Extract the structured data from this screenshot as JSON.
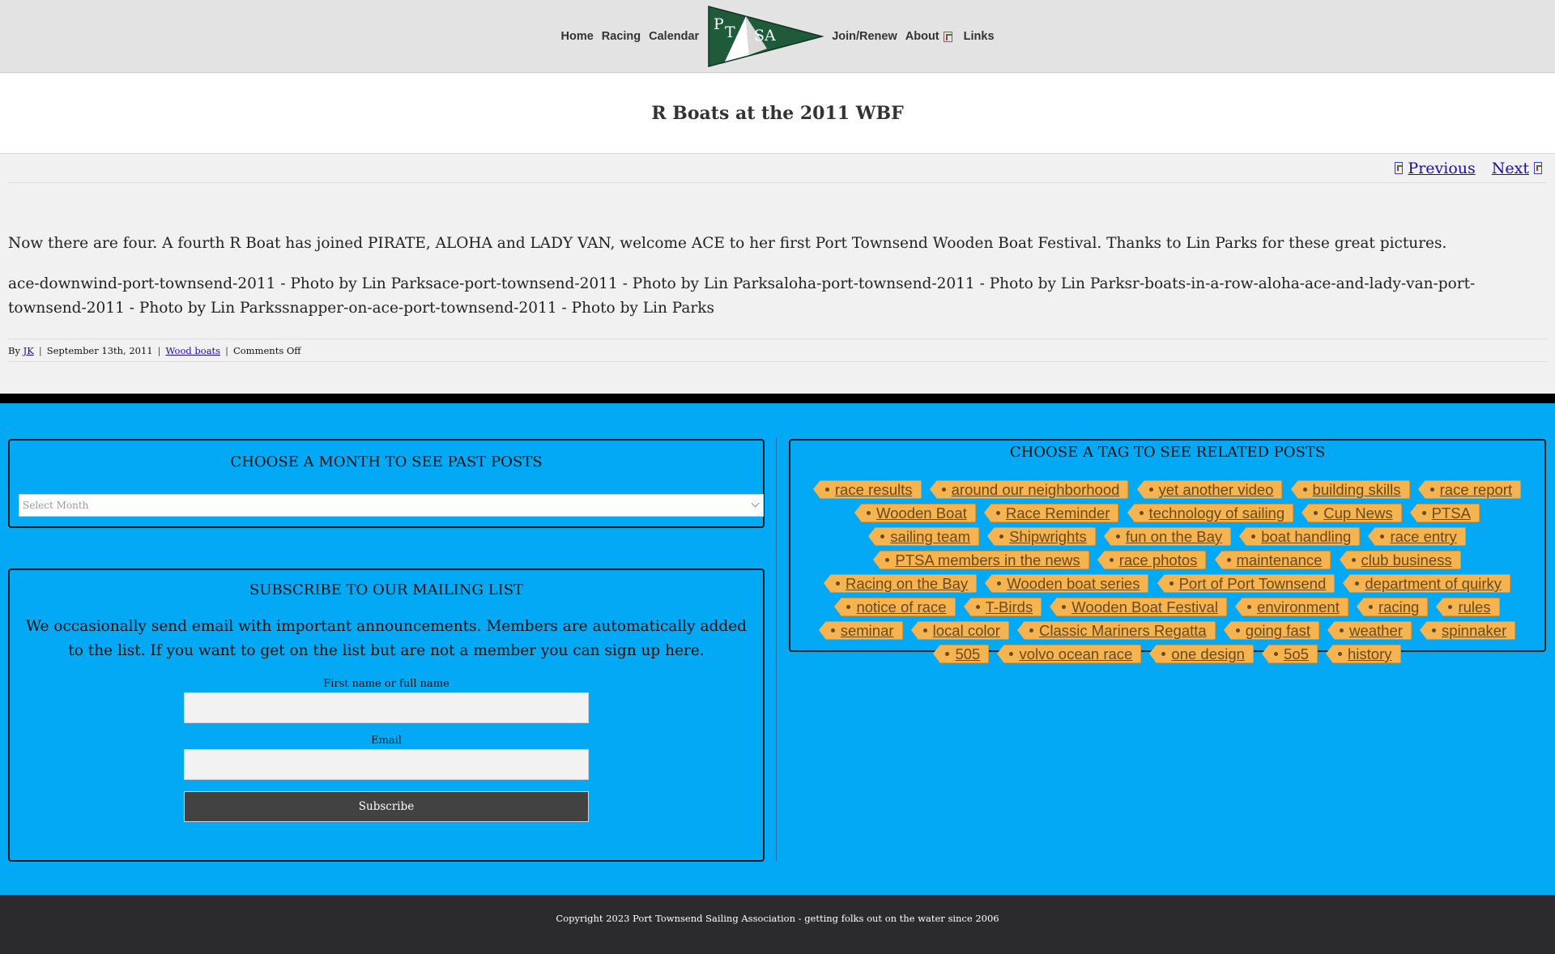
{
  "nav": {
    "items_left": [
      "Home",
      "Racing",
      "Calendar"
    ],
    "logo_letters": [
      "P",
      "T",
      "SA"
    ],
    "items_right": [
      "Join/Renew",
      "About",
      "Links"
    ],
    "brand_color": "#1f5a3a"
  },
  "post": {
    "title": "R Boats at the 2011 WBF",
    "nav_previous": "Previous",
    "nav_next": "Next",
    "paragraph1": "Now there are four. A fourth R Boat has joined PIRATE, ALOHA and LADY VAN, welcome ACE to her first Port Townsend Wooden Boat Festival. Thanks to Lin Parks for these great pictures.",
    "paragraph2": "ace-downwind-port-townsend-2011 - Photo by Lin Parksace-port-townsend-2011 - Photo by Lin Parksaloha-port-townsend-2011 - Photo by Lin Parksr-boats-in-a-row-aloha-ace-and-lady-van-port-townsend-2011 - Photo by Lin Parkssnapper-on-ace-port-townsend-2011 - Photo by Lin Parks",
    "meta": {
      "by": "By",
      "author": "JK",
      "date": "September 13th, 2011",
      "category": "Wood boats",
      "comments": "Comments Off"
    }
  },
  "archive": {
    "heading": "CHOOSE A MONTH TO SEE PAST POSTS",
    "select_value": "Select Month"
  },
  "subscribe": {
    "heading": "SUBSCRIBE TO OUR MAILING LIST",
    "text": "We occasionally send email with important announcements. Members are automatically added to the list. If you want to get on the list but are not a member you can sign up here.",
    "name_label": "First name or full name",
    "email_label": "Email",
    "button": "Subscribe"
  },
  "tags": {
    "heading": "CHOOSE A TAG TO SEE RELATED POSTS",
    "items": [
      "race results",
      "around our neighborhood",
      "yet another video",
      "building skills",
      "race report",
      "Wooden Boat",
      "Race Reminder",
      "technology of sailing",
      "Cup News",
      "PTSA",
      "sailing team",
      "Shipwrights",
      "fun on the Bay",
      "boat handling",
      "race entry",
      "PTSA members in the news",
      "race photos",
      "maintenance",
      "club business",
      "Racing on the Bay",
      "Wooden boat series",
      "Port of Port Townsend",
      "department of quirky",
      "notice of race",
      "T-Birds",
      "Wooden Boat Festival",
      "environment",
      "racing",
      "rules",
      "seminar",
      "local color",
      "Classic Mariners Regatta",
      "going fast",
      "weather",
      "spinnaker",
      "505",
      "volvo ocean race",
      "one design",
      "5o5",
      "history"
    ],
    "tag_color": "#f6b451"
  },
  "footer": {
    "copyright": "Copyright 2023 Port Townsend Sailing Association - getting folks out on the water since 2006",
    "widget_bg": "#03a9f4"
  }
}
